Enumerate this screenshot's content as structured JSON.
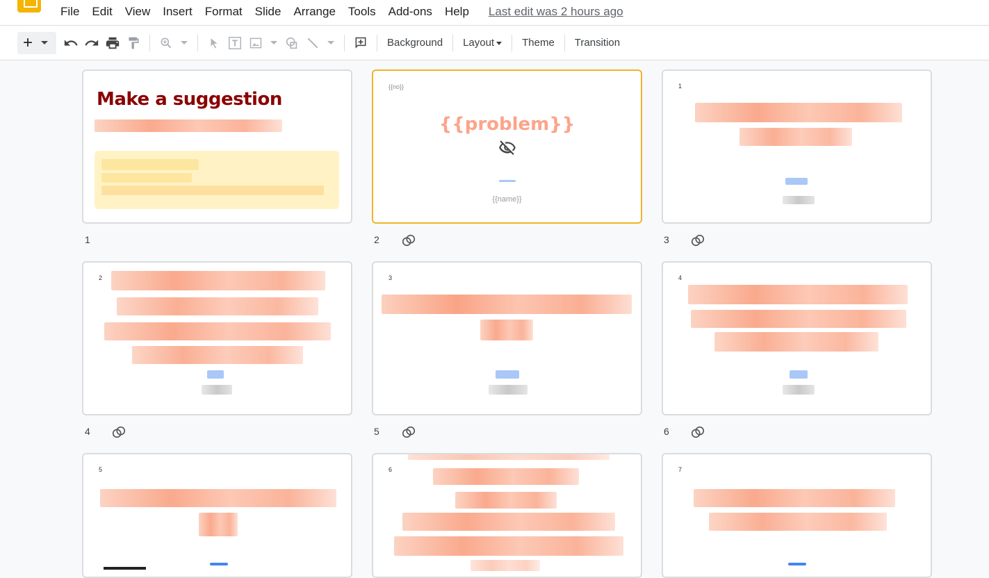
{
  "menu": {
    "items": [
      "File",
      "Edit",
      "View",
      "Insert",
      "Format",
      "Slide",
      "Arrange",
      "Tools",
      "Add-ons",
      "Help"
    ],
    "last_edit": "Last edit was 2 hours ago"
  },
  "toolbar": {
    "background": "Background",
    "layout": "Layout",
    "theme": "Theme",
    "transition": "Transition"
  },
  "slides": [
    {
      "num": "1",
      "title": "Make a suggestion"
    },
    {
      "num": "2",
      "no_field": "{{no}}",
      "problem": "{{problem}}",
      "name_field": "{{name}}"
    },
    {
      "num": "3",
      "small_no": "1"
    },
    {
      "num": "4",
      "small_no": "2"
    },
    {
      "num": "5",
      "small_no": "3"
    },
    {
      "num": "6",
      "small_no": "4"
    },
    {
      "small_no": "5"
    },
    {
      "small_no": "6"
    },
    {
      "small_no": "7"
    }
  ],
  "colors": {
    "accent": "#f0b429",
    "title": "#8b0000",
    "problem": "#fca48a"
  }
}
